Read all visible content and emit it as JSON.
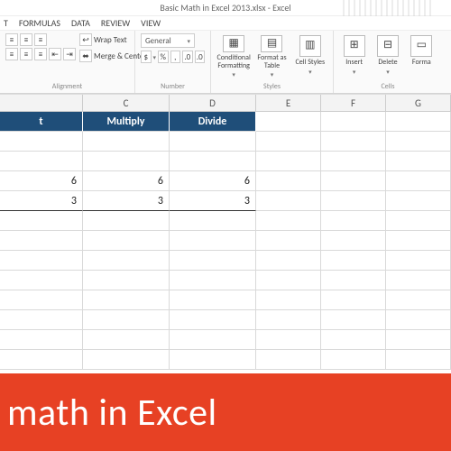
{
  "title": "Basic Math in Excel 2013.xlsx - Excel",
  "tabs": {
    "t1": "T",
    "formulas": "FORMULAS",
    "data": "DATA",
    "review": "REVIEW",
    "view": "VIEW"
  },
  "ribbon": {
    "alignment": {
      "wrap": "Wrap Text",
      "merge": "Merge & Center",
      "label": "Alignment"
    },
    "number": {
      "format": "General",
      "currency": "$",
      "percent": "%",
      "comma": ",",
      "label": "Number"
    },
    "styles": {
      "cond": "Conditional Formatting",
      "table": "Format as Table",
      "cell": "Cell Styles",
      "label": "Styles"
    },
    "cells": {
      "insert": "Insert",
      "delete": "Delete",
      "format": "Forma",
      "label": "Cells"
    }
  },
  "cols": {
    "lead": "",
    "c": "C",
    "d": "D",
    "e": "E",
    "f": "F",
    "g": "G"
  },
  "headers": {
    "b": "t",
    "c": "Multiply",
    "d": "Divide"
  },
  "dataRows": {
    "r4": {
      "b": "6",
      "c": "6",
      "d": "6"
    },
    "r5": {
      "b": "3",
      "c": "3",
      "d": "3"
    }
  },
  "banner": "math in Excel"
}
